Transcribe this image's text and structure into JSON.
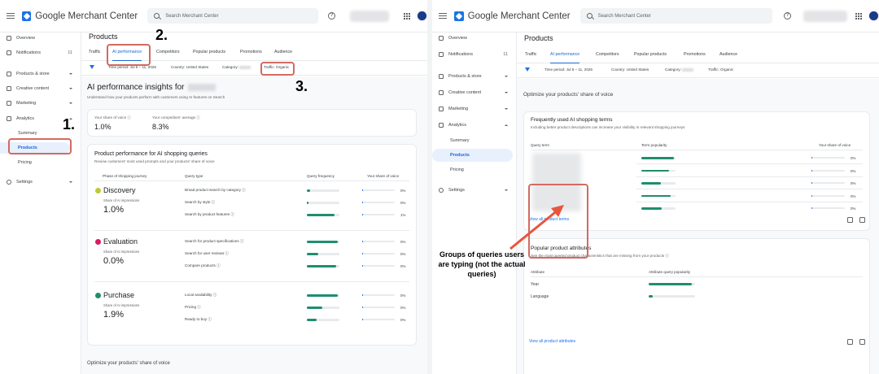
{
  "app": {
    "brand": "Google Merchant Center",
    "search_placeholder": "Search Merchant Center"
  },
  "sidebar": {
    "items": [
      {
        "label": "Overview",
        "icon": "grid-icon"
      },
      {
        "label": "Notifications",
        "icon": "bell-icon",
        "badge": "11"
      },
      {
        "label": "Products & store",
        "icon": "store-icon"
      },
      {
        "label": "Creative content",
        "icon": "creative-icon"
      },
      {
        "label": "Marketing",
        "icon": "marketing-icon"
      },
      {
        "label": "Analytics",
        "icon": "analytics-icon"
      },
      {
        "label": "Summary"
      },
      {
        "label": "Products"
      },
      {
        "label": "Pricing"
      },
      {
        "label": "Settings",
        "icon": "gear-icon"
      }
    ]
  },
  "page": {
    "title": "Products"
  },
  "tabs": [
    "Traffic",
    "AI performance",
    "Competitors",
    "Popular products",
    "Promotions",
    "Audience"
  ],
  "filters": {
    "time": "Time period: Jul 5 – 11, 2026",
    "country": "Country: United States",
    "category": "Category:",
    "traffic": "Traffic: Organic"
  },
  "insights": {
    "title": "AI performance insights for",
    "subtitle": "Understand how your products perform with customers using AI features on Search",
    "share_label": "Your share of voice",
    "share_value": "1.0%",
    "comp_label": "Your competitors' average",
    "comp_value": "8.3%"
  },
  "perf_card": {
    "title": "Product performance for AI shopping queries",
    "subtitle": "Review customers' most used prompts and your products' share of voice",
    "col_phase": "Phase of shopping journey",
    "col_type": "Query type",
    "col_freq": "Query frequency",
    "col_share": "Your share of voice",
    "phase_metric": "Share of AI impressions",
    "phases": [
      {
        "name": "Discovery",
        "value": "1.0%",
        "color": "#c0ca33",
        "rows": [
          {
            "type": "Broad product search by category",
            "freq": 0.09,
            "share": 0.0,
            "share_label": "0%"
          },
          {
            "type": "Search by style",
            "freq": 0.06,
            "share": 0.0,
            "share_label": "0%"
          },
          {
            "type": "Search by product features",
            "freq": 0.85,
            "share": 0.01,
            "share_label": "1%"
          }
        ]
      },
      {
        "name": "Evaluation",
        "value": "0.0%",
        "color": "#d81b60",
        "rows": [
          {
            "type": "Search for product specifications",
            "freq": 0.96,
            "share": 0.0,
            "share_label": "0%"
          },
          {
            "type": "Search for user reviews",
            "freq": 0.35,
            "share": 0.0,
            "share_label": "0%"
          },
          {
            "type": "Compare products",
            "freq": 0.9,
            "share": 0.0,
            "share_label": "0%"
          }
        ]
      },
      {
        "name": "Purchase",
        "value": "1.9%",
        "color": "#1e8e6e",
        "rows": [
          {
            "type": "Local availability",
            "freq": 0.95,
            "share": 0.0,
            "share_label": "0%"
          },
          {
            "type": "Pricing",
            "freq": 0.48,
            "share": 0.0,
            "share_label": "0%"
          },
          {
            "type": "Ready to buy",
            "freq": 0.3,
            "share": 0.0,
            "share_label": "0%"
          }
        ]
      }
    ]
  },
  "optimize": {
    "title": "Optimize your products' share of voice"
  },
  "terms_card": {
    "title": "Frequently used AI shopping terms",
    "subtitle": "Including better product descriptions can increase your visibility in relevant shopping journeys",
    "col_term": "Query term",
    "col_pop": "Term popularity",
    "col_share": "Your share of voice",
    "rows": [
      {
        "pop": 0.95,
        "share_label": "0%"
      },
      {
        "pop": 0.82,
        "share_label": "0%"
      },
      {
        "pop": 0.58,
        "share_label": "0%"
      },
      {
        "pop": 0.85,
        "share_label": "0%"
      },
      {
        "pop": 0.6,
        "share_label": "0%"
      }
    ],
    "link": "View all product terms"
  },
  "attr_card": {
    "title": "Popular product attributes",
    "subtitle": "See the most queried product characteristics that are missing from your products",
    "col_attr": "Attribute",
    "col_pop": "Attribute query popularity",
    "rows": [
      {
        "label": "Year",
        "pop": 0.93
      },
      {
        "label": "Language",
        "pop": 0.08
      }
    ],
    "link": "View all product attributes"
  },
  "annotations": {
    "n1": "1.",
    "n2": "2.",
    "n3": "3.",
    "caption": "Groups of queries users are typing (not the actual queries)",
    "highlight_color": "#d36a61",
    "arrow_color": "#e8553e"
  }
}
